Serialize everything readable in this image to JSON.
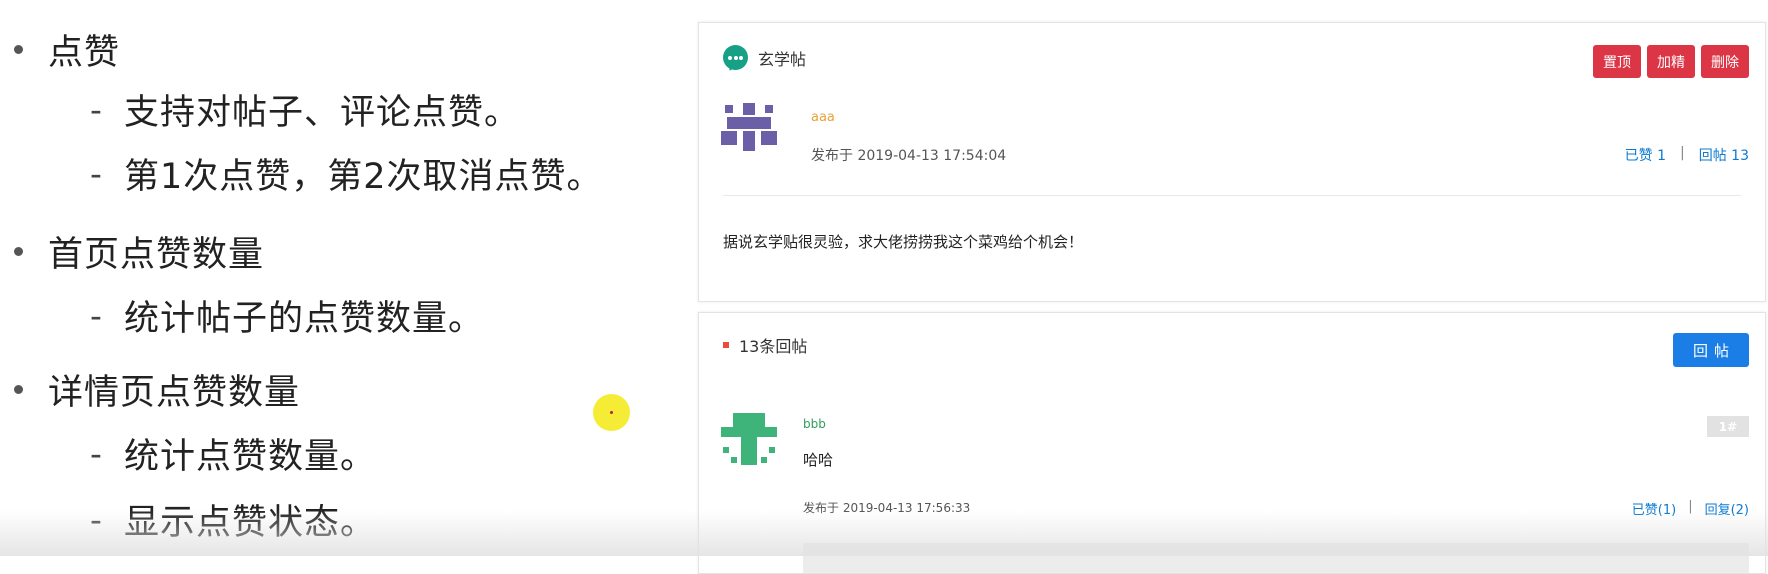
{
  "outline": {
    "bullets": [
      {
        "text": "点赞",
        "subs": [
          "支持对帖子、评论点赞。",
          "第1次点赞，第2次取消点赞。"
        ]
      },
      {
        "text": "首页点赞数量",
        "subs": [
          "统计帖子的点赞数量。"
        ]
      },
      {
        "text": "详情页点赞数量",
        "subs": [
          "统计点赞数量。",
          "显示点赞状态。"
        ]
      }
    ],
    "dash": "-"
  },
  "post": {
    "title": "玄学帖",
    "buttons": {
      "top": "置顶",
      "highlight": "加精",
      "delete": "删除"
    },
    "author": "aaa",
    "time": "发布于 2019-04-13 17:54:04",
    "likes": "已赞 1",
    "separator": "|",
    "replies": "回帖 13",
    "content": "据说玄学贴很灵验，求大佬捞捞我这个菜鸡给个机会！"
  },
  "replies_section": {
    "count_label": "13条回帖",
    "reply_button": "回帖",
    "items": [
      {
        "author": "bbb",
        "floor": "1#",
        "content": "哈哈",
        "time": "发布于 2019-04-13 17:56:33",
        "likes": "已赞(1)",
        "separator": "|",
        "reply": "回复(2)"
      }
    ]
  },
  "colors": {
    "danger": "#dc3545",
    "primary": "#1a7ee6",
    "link": "#0b7ad1",
    "author_aaa": "#e8a33a",
    "author_bbb": "#2e9d5a",
    "avatar_aaa": "#6b60a8",
    "avatar_bbb": "#3fb47a",
    "chat_icon": "#16a085"
  }
}
